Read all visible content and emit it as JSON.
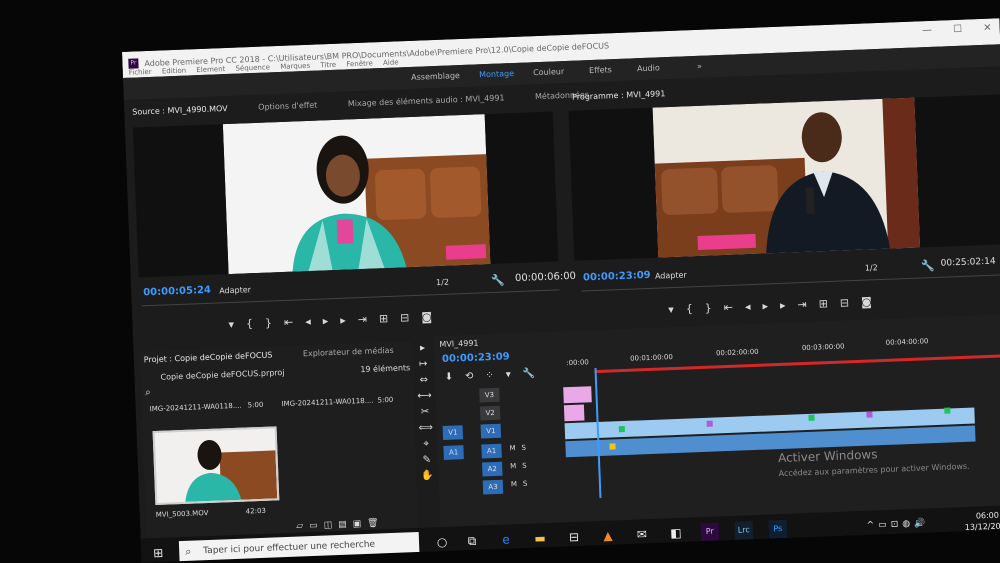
{
  "window": {
    "title": "Adobe Premiere Pro CC 2018 - C:\\Utilisateurs\\BM PRO\\Documents\\Adobe\\Premiere Pro\\12.0\\Copie deCopie deFOCUS",
    "menus": [
      "Fichier",
      "Edition",
      "Element",
      "Séquence",
      "Marques",
      "Titre",
      "Fenêtre",
      "Aide"
    ]
  },
  "workspaces": {
    "tabs": [
      "Assemblage",
      "Montage",
      "Couleur",
      "Effets",
      "Audio"
    ],
    "active": "Montage",
    "more": "»"
  },
  "source_monitor": {
    "tabs": [
      "Source : MVI_4990.MOV",
      "Options d'effet",
      "Mixage des éléments audio : MVI_4991",
      "Métadonnées"
    ],
    "timecode": "00:00:05:24",
    "fit": "Adapter",
    "resolution": "1/2",
    "duration": "00:00:06:00"
  },
  "program_monitor": {
    "tab": "Programme : MVI_4991",
    "timecode": "00:00:23:09",
    "fit": "Adapter",
    "resolution": "1/2",
    "duration": "00:25:02:14"
  },
  "project": {
    "tabs": [
      "Projet : Copie deCopie deFOCUS",
      "Explorateur de médias"
    ],
    "filename": "Copie deCopie deFOCUS.prproj",
    "count": "19 éléments",
    "items_top": [
      {
        "name": "IMG-20241211-WA0118....",
        "duration": "5:00"
      },
      {
        "name": "IMG-20241211-WA0118....",
        "duration": "5:00"
      }
    ],
    "thumb": {
      "name": "MVI_5003.MOV",
      "duration": "42:03"
    }
  },
  "timeline": {
    "sequence": "MVI_4991",
    "timecode": "00:00:23:09",
    "ruler": [
      ":00:00",
      "00:01:00:00",
      "00:02:00:00",
      "00:03:00:00",
      "00:04:00:00"
    ],
    "video_tracks": [
      "V3",
      "V2",
      "V1"
    ],
    "audio_tracks": [
      "A1",
      "A2",
      "A3"
    ],
    "source_patch_v": "V1",
    "source_patch_a": "A1",
    "track_flags": [
      "M",
      "S"
    ]
  },
  "watermark": {
    "title": "Activer Windows",
    "subtitle": "Accédez aux paramètres pour activer Windows."
  },
  "taskbar": {
    "search_placeholder": "Taper ici pour effectuer une recherche",
    "time": "06:00",
    "date": "13/12/2024"
  }
}
